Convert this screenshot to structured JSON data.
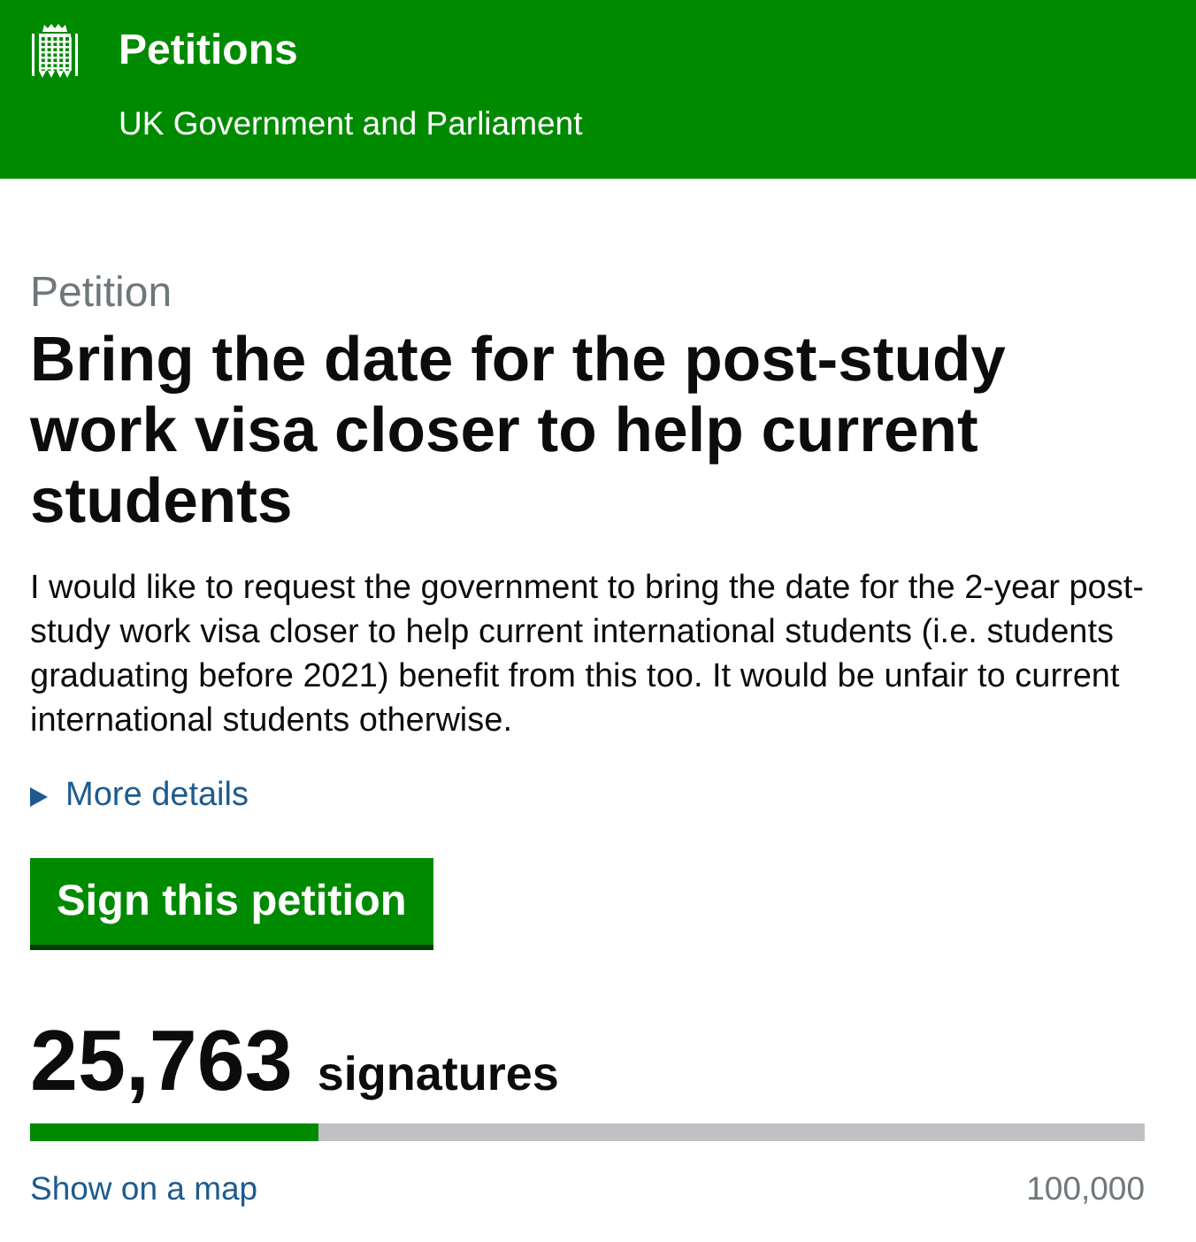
{
  "header": {
    "title": "Petitions",
    "subtitle": "UK Government and Parliament"
  },
  "petition": {
    "label": "Petition",
    "title": "Bring the date for the post-study work visa closer to help current students",
    "summary": "I would like to request the government to bring the date for the 2-year post-study work visa closer to help current international students (i.e. students graduating before 2021) benefit from this too. It would be unfair to current international students otherwise.",
    "details": {
      "label": "More details",
      "expanded": false
    },
    "sign_button": "Sign this petition"
  },
  "signatures": {
    "count": "25,763",
    "unit": "signatures",
    "level": 0.258,
    "map_link": "Show on a map",
    "target": "100,000"
  }
}
